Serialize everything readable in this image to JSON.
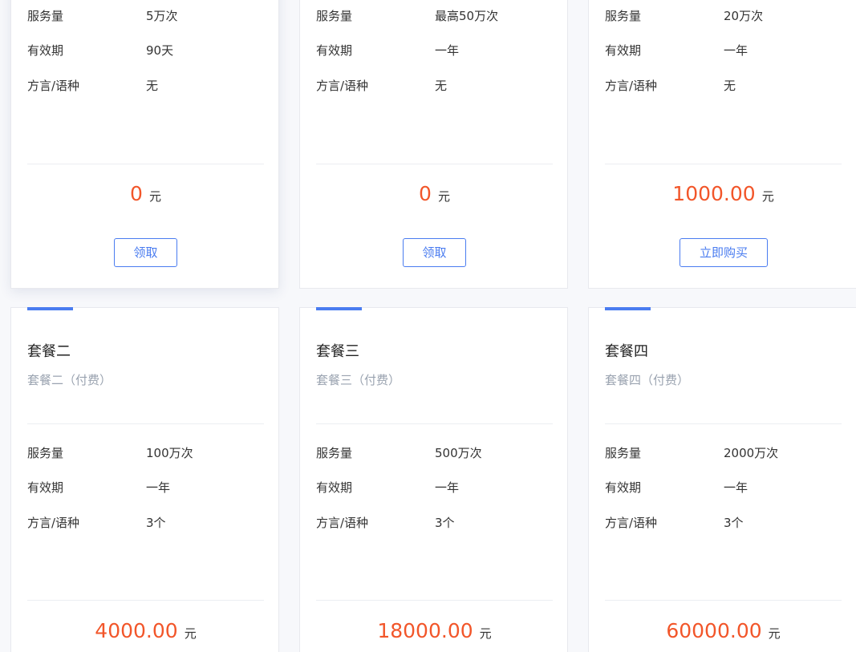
{
  "labels": {
    "service": "服务量",
    "validity": "有效期",
    "dialect": "方言/语种"
  },
  "currency_unit": "元",
  "top_row": [
    {
      "service": "5万次",
      "validity": "90天",
      "dialect": "无",
      "price": "0",
      "button": "领取"
    },
    {
      "service": "最高50万次",
      "validity": "一年",
      "dialect": "无",
      "price": "0",
      "button": "领取"
    },
    {
      "service": "20万次",
      "validity": "一年",
      "dialect": "无",
      "price": "1000.00",
      "button": "立即购买"
    }
  ],
  "bottom_row": [
    {
      "title": "套餐二",
      "subtitle": "套餐二（付费）",
      "service": "100万次",
      "validity": "一年",
      "dialect": "3个",
      "price": "4000.00"
    },
    {
      "title": "套餐三",
      "subtitle": "套餐三（付费）",
      "service": "500万次",
      "validity": "一年",
      "dialect": "3个",
      "price": "18000.00"
    },
    {
      "title": "套餐四",
      "subtitle": "套餐四（付费）",
      "service": "2000万次",
      "validity": "一年",
      "dialect": "3个",
      "price": "60000.00"
    }
  ],
  "colors": {
    "accent": "#4a7cf0",
    "price": "#f2562a",
    "muted": "#9aa3b0",
    "background": "#f7f8fb"
  }
}
